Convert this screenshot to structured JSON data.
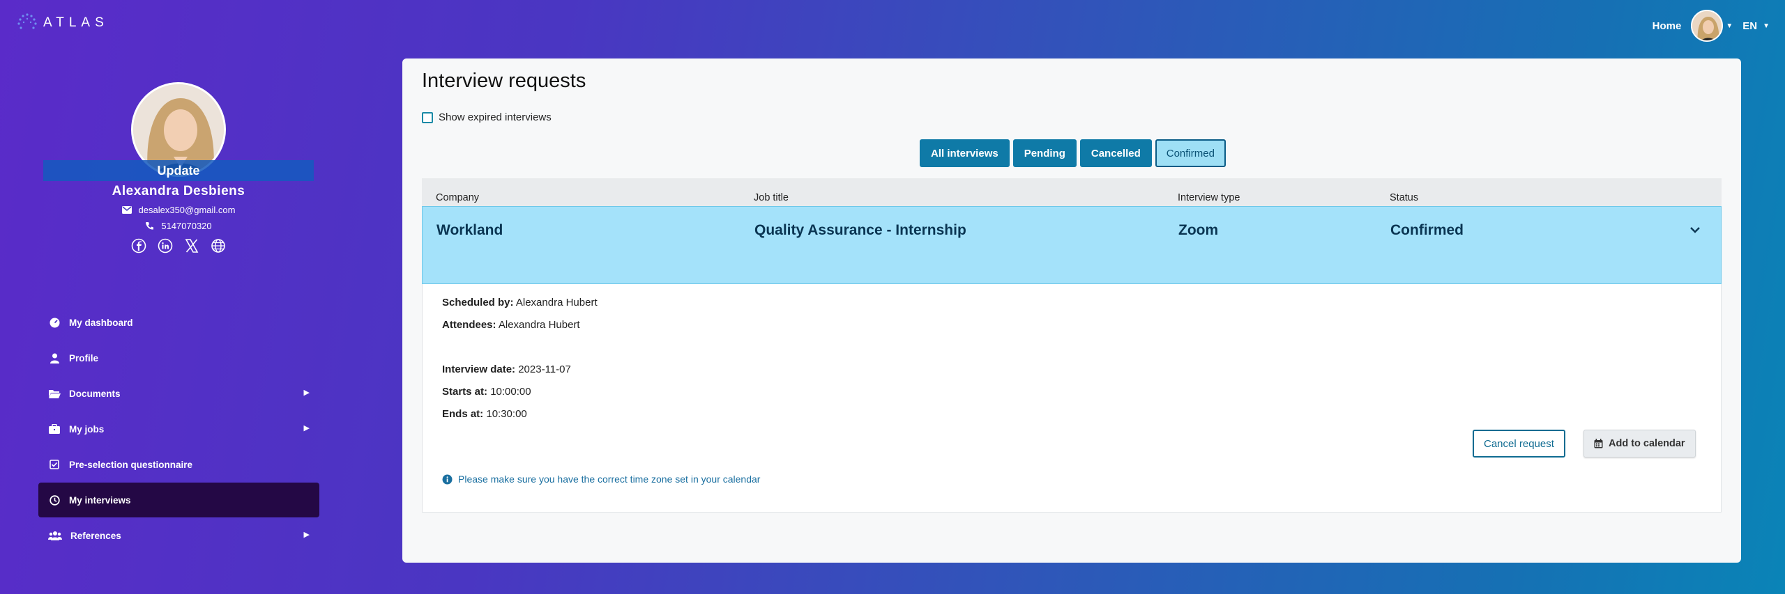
{
  "header": {
    "logo_text": "ATLAS",
    "home_label": "Home",
    "lang_label": "EN"
  },
  "profile": {
    "update_label": "Update",
    "name": "Alexandra  Desbiens",
    "email": "desalex350@gmail.com",
    "phone": "5147070320",
    "socials": [
      "facebook-icon",
      "linkedin-icon",
      "x-icon",
      "globe-icon"
    ]
  },
  "sidebar": {
    "items": [
      {
        "label": "My dashboard",
        "icon": "dashboard-icon",
        "submenu": false
      },
      {
        "label": "Profile",
        "icon": "user-icon",
        "submenu": false
      },
      {
        "label": "Documents",
        "icon": "folder-icon",
        "submenu": true
      },
      {
        "label": "My jobs",
        "icon": "briefcase-icon",
        "submenu": true
      },
      {
        "label": "Pre-selection questionnaire",
        "icon": "checkbox-icon",
        "submenu": false
      },
      {
        "label": "My interviews",
        "icon": "clock-icon",
        "submenu": false,
        "active": true
      },
      {
        "label": "References",
        "icon": "users-icon",
        "submenu": true
      }
    ]
  },
  "main": {
    "title": "Interview requests",
    "show_expired_label": "Show expired interviews",
    "filters": [
      "All interviews",
      "Pending",
      "Cancelled",
      "Confirmed"
    ],
    "selected_filter": "Confirmed",
    "columns": [
      "Company",
      "Job title",
      "Interview type",
      "Status"
    ],
    "row": {
      "company": "Workland",
      "job_title": "Quality Assurance - Internship",
      "interview_type": "Zoom",
      "status": "Confirmed"
    },
    "details": {
      "scheduled_by_label": "Scheduled by:",
      "scheduled_by": "Alexandra Hubert",
      "attendees_label": "Attendees:",
      "attendees": "Alexandra Hubert",
      "date_label": "Interview date:",
      "date": "2023-11-07",
      "starts_label": "Starts at:",
      "starts": "10:00:00",
      "ends_label": "Ends at:",
      "ends": "10:30:00",
      "cancel_label": "Cancel request",
      "calendar_label": "Add to calendar",
      "note": "Please make sure you have the correct time zone set in your calendar"
    }
  }
}
